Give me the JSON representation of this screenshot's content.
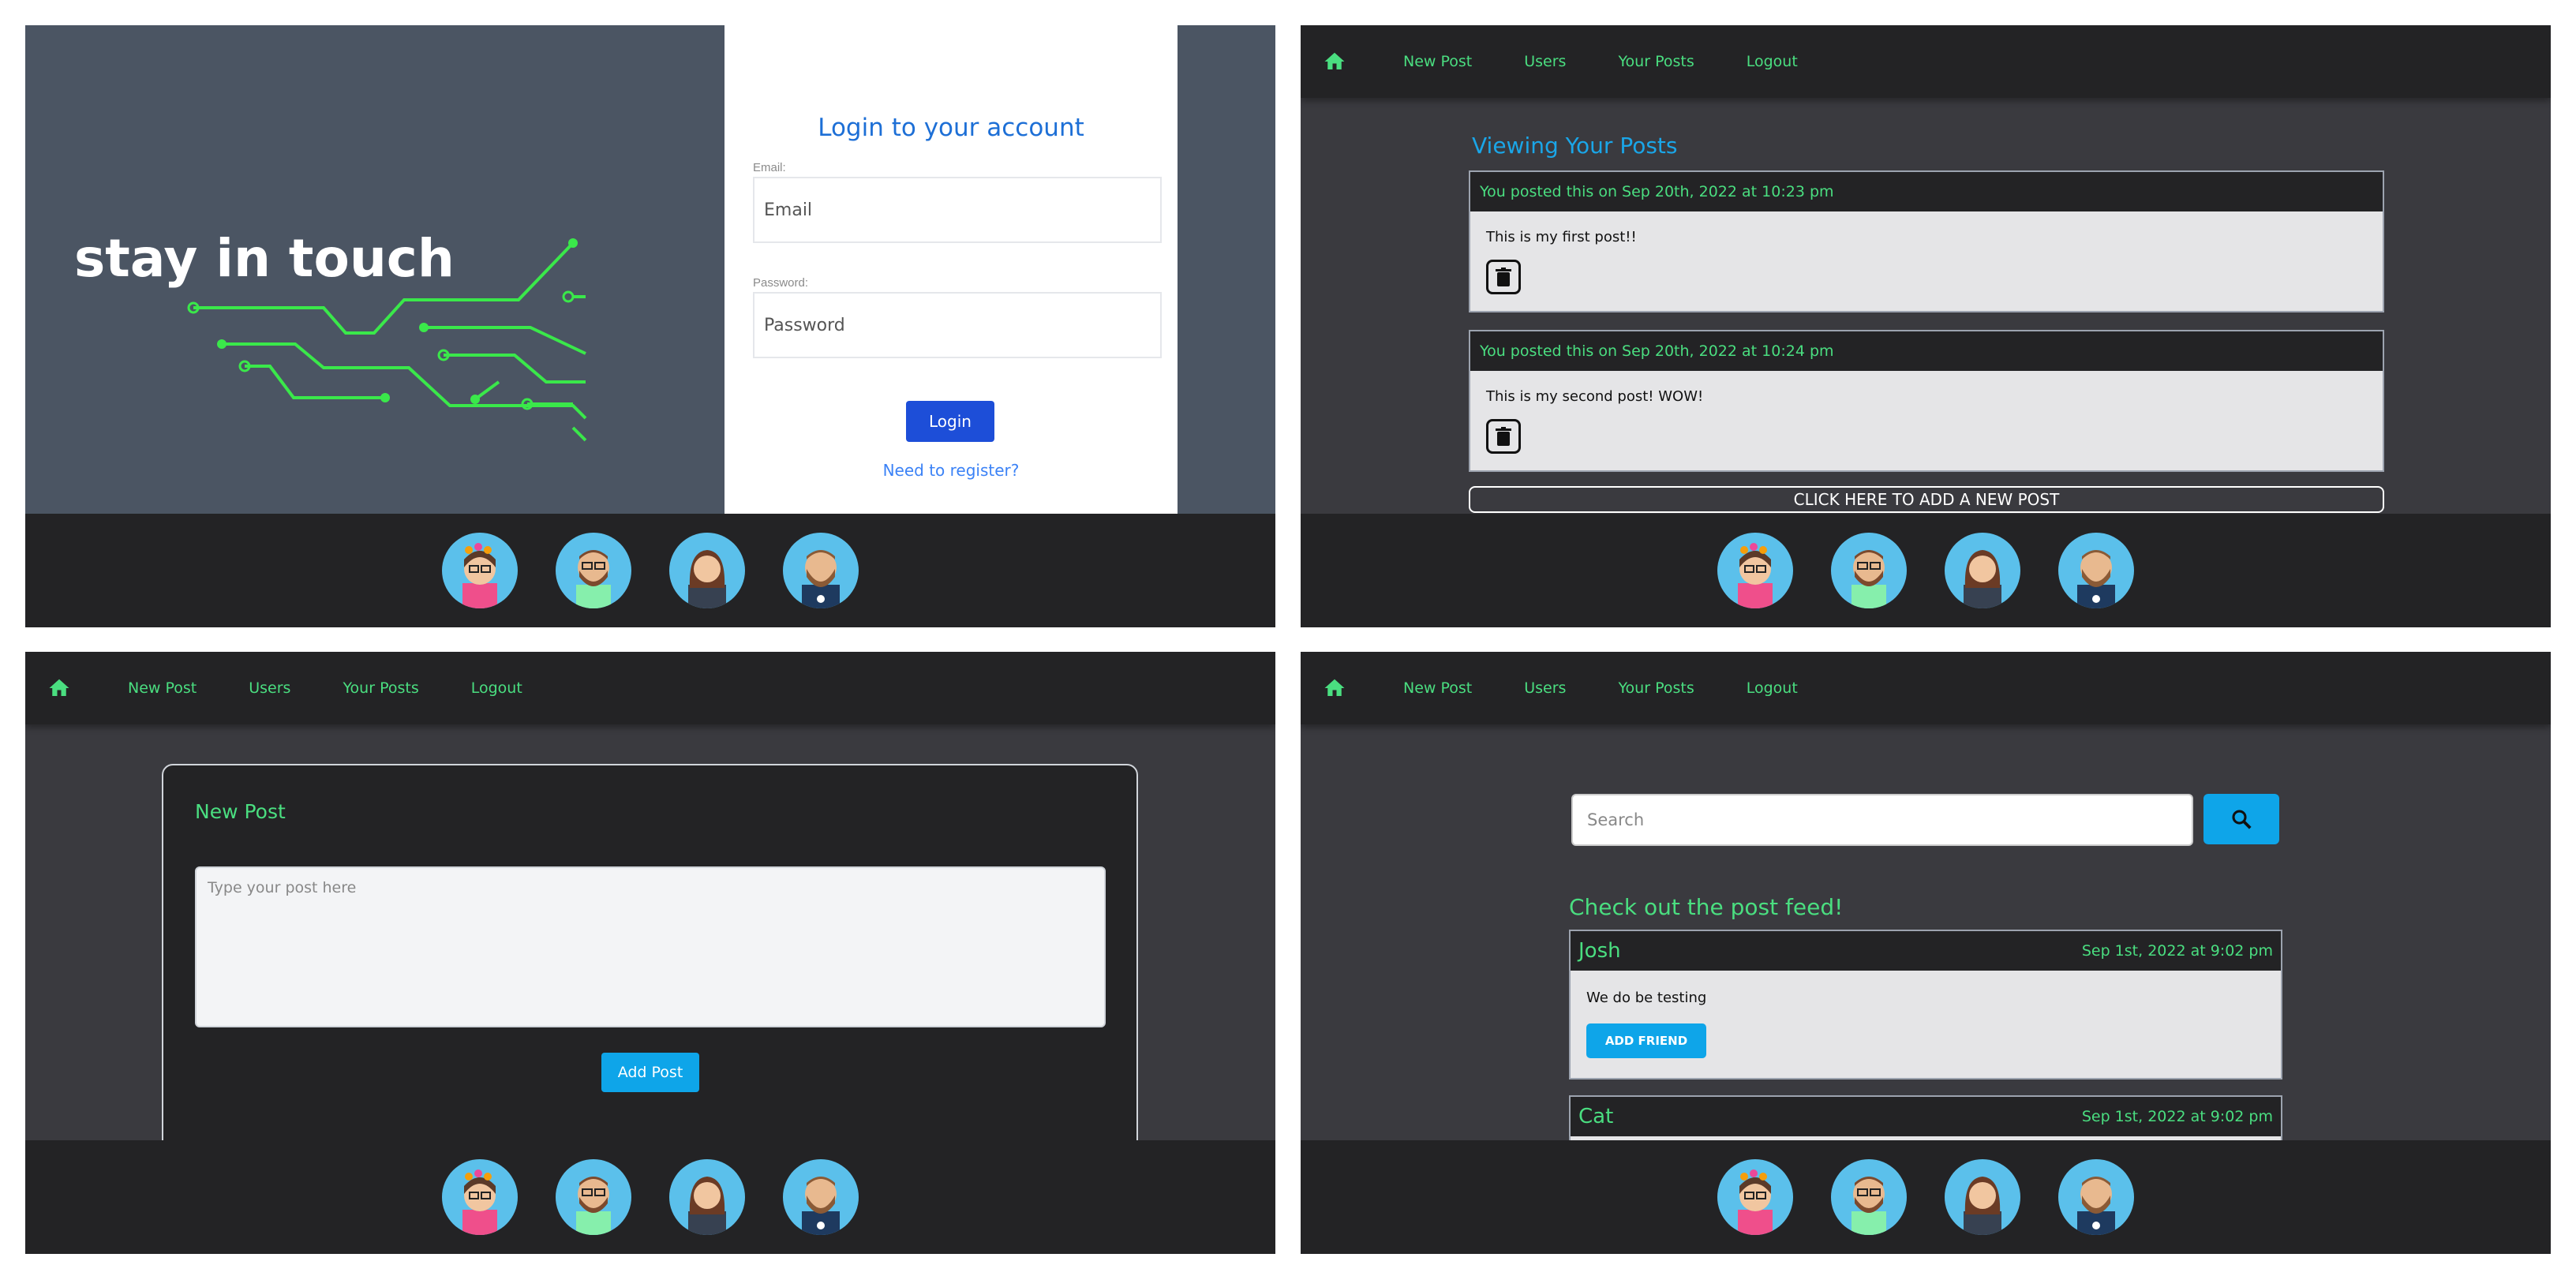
{
  "brand": {
    "logo_text": "stay in touch"
  },
  "login": {
    "title": "Login to your account",
    "email_label": "Email:",
    "email_placeholder": "Email",
    "password_label": "Password:",
    "password_placeholder": "Password",
    "login_button": "Login",
    "register_link": "Need to register?"
  },
  "nav": {
    "home_icon": "home-icon",
    "items": [
      {
        "label": "New Post"
      },
      {
        "label": "Users"
      },
      {
        "label": "Your Posts"
      },
      {
        "label": "Logout"
      }
    ]
  },
  "your_posts": {
    "title": "Viewing Your Posts",
    "posts": [
      {
        "header": "You posted this on Sep 20th, 2022 at 10:23 pm",
        "body": "This is my first post!!"
      },
      {
        "header": "You posted this on Sep 20th, 2022 at 10:24 pm",
        "body": "This is my second post! WOW!"
      }
    ],
    "add_new": "CLICK HERE TO ADD A NEW POST"
  },
  "new_post": {
    "title": "New Post",
    "placeholder": "Type your post here",
    "button": "Add Post"
  },
  "feed": {
    "search_placeholder": "Search",
    "title": "Check out the post feed!",
    "posts": [
      {
        "name": "Josh",
        "date": "Sep 1st, 2022 at 9:02 pm",
        "body": "We do be testing",
        "button": "ADD FRIEND"
      },
      {
        "name": "Cat",
        "date": "Sep 1st, 2022 at 9:02 pm"
      }
    ]
  },
  "footer": {
    "avatars": [
      "avatar-woman-flower-crown",
      "avatar-man-glasses-beard",
      "avatar-woman-long-hair",
      "avatar-man-beard-shirt"
    ]
  },
  "colors": {
    "accent_green": "#4ade80",
    "accent_blue": "#0ea5e9",
    "nav_bg": "#232325",
    "panel_bg": "#3a3a3f"
  }
}
